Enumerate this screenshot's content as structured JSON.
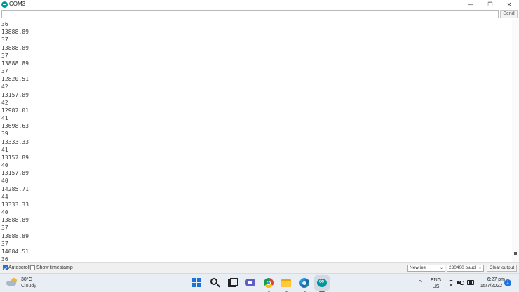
{
  "window": {
    "title": "COM3",
    "controls": {
      "minimize": "—",
      "maximize": "❐",
      "close": "✕"
    }
  },
  "send_bar": {
    "input_value": "",
    "send_label": "Send"
  },
  "serial_output": {
    "lines": [
      "36",
      "13888.89",
      "37",
      "13888.89",
      "37",
      "13888.89",
      "37",
      "12820.51",
      "42",
      "13157.89",
      "42",
      "12987.01",
      "41",
      "13698.63",
      "39",
      "13333.33",
      "41",
      "13157.89",
      "40",
      "13157.89",
      "40",
      "14285.71",
      "44",
      "13333.33",
      "40",
      "13888.89",
      "37",
      "13888.89",
      "37",
      "14084.51",
      "36"
    ]
  },
  "bottom_bar": {
    "autoscroll_label": "Autoscroll",
    "autoscroll_checked": true,
    "timestamp_label": "Show timestamp",
    "timestamp_checked": false,
    "line_ending_value": "Newline",
    "baud_value": "230400 baud",
    "clear_label": "Clear output"
  },
  "taskbar": {
    "weather": {
      "temp": "30°C",
      "condition": "Cloudy"
    },
    "apps": [
      "start-icon",
      "search-icon",
      "taskview-icon",
      "chat-icon",
      "chrome-icon",
      "file-explorer-icon",
      "edge-icon",
      "arduino-icon"
    ],
    "tray": {
      "chevron": "^",
      "lang_line1": "ENG",
      "lang_line2": "US",
      "time": "6:27 pm",
      "date": "15/7/2022",
      "notifications": "1"
    }
  },
  "colors": {
    "accent": "#1a73d9",
    "arduino": "#00979c",
    "taskbar": "#e9eef5"
  }
}
